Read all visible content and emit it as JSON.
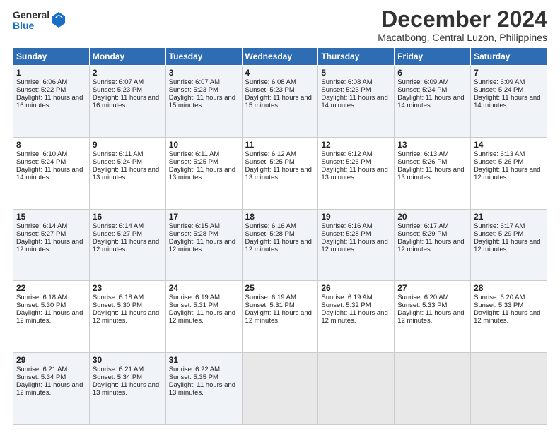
{
  "logo": {
    "general": "General",
    "blue": "Blue"
  },
  "title": "December 2024",
  "subtitle": "Macatbong, Central Luzon, Philippines",
  "days": [
    "Sunday",
    "Monday",
    "Tuesday",
    "Wednesday",
    "Thursday",
    "Friday",
    "Saturday"
  ],
  "weeks": [
    [
      {
        "day": "1",
        "sunrise": "Sunrise: 6:06 AM",
        "sunset": "Sunset: 5:22 PM",
        "daylight": "Daylight: 11 hours and 16 minutes."
      },
      {
        "day": "2",
        "sunrise": "Sunrise: 6:07 AM",
        "sunset": "Sunset: 5:23 PM",
        "daylight": "Daylight: 11 hours and 16 minutes."
      },
      {
        "day": "3",
        "sunrise": "Sunrise: 6:07 AM",
        "sunset": "Sunset: 5:23 PM",
        "daylight": "Daylight: 11 hours and 15 minutes."
      },
      {
        "day": "4",
        "sunrise": "Sunrise: 6:08 AM",
        "sunset": "Sunset: 5:23 PM",
        "daylight": "Daylight: 11 hours and 15 minutes."
      },
      {
        "day": "5",
        "sunrise": "Sunrise: 6:08 AM",
        "sunset": "Sunset: 5:23 PM",
        "daylight": "Daylight: 11 hours and 14 minutes."
      },
      {
        "day": "6",
        "sunrise": "Sunrise: 6:09 AM",
        "sunset": "Sunset: 5:24 PM",
        "daylight": "Daylight: 11 hours and 14 minutes."
      },
      {
        "day": "7",
        "sunrise": "Sunrise: 6:09 AM",
        "sunset": "Sunset: 5:24 PM",
        "daylight": "Daylight: 11 hours and 14 minutes."
      }
    ],
    [
      {
        "day": "8",
        "sunrise": "Sunrise: 6:10 AM",
        "sunset": "Sunset: 5:24 PM",
        "daylight": "Daylight: 11 hours and 14 minutes."
      },
      {
        "day": "9",
        "sunrise": "Sunrise: 6:11 AM",
        "sunset": "Sunset: 5:24 PM",
        "daylight": "Daylight: 11 hours and 13 minutes."
      },
      {
        "day": "10",
        "sunrise": "Sunrise: 6:11 AM",
        "sunset": "Sunset: 5:25 PM",
        "daylight": "Daylight: 11 hours and 13 minutes."
      },
      {
        "day": "11",
        "sunrise": "Sunrise: 6:12 AM",
        "sunset": "Sunset: 5:25 PM",
        "daylight": "Daylight: 11 hours and 13 minutes."
      },
      {
        "day": "12",
        "sunrise": "Sunrise: 6:12 AM",
        "sunset": "Sunset: 5:26 PM",
        "daylight": "Daylight: 11 hours and 13 minutes."
      },
      {
        "day": "13",
        "sunrise": "Sunrise: 6:13 AM",
        "sunset": "Sunset: 5:26 PM",
        "daylight": "Daylight: 11 hours and 13 minutes."
      },
      {
        "day": "14",
        "sunrise": "Sunrise: 6:13 AM",
        "sunset": "Sunset: 5:26 PM",
        "daylight": "Daylight: 11 hours and 12 minutes."
      }
    ],
    [
      {
        "day": "15",
        "sunrise": "Sunrise: 6:14 AM",
        "sunset": "Sunset: 5:27 PM",
        "daylight": "Daylight: 11 hours and 12 minutes."
      },
      {
        "day": "16",
        "sunrise": "Sunrise: 6:14 AM",
        "sunset": "Sunset: 5:27 PM",
        "daylight": "Daylight: 11 hours and 12 minutes."
      },
      {
        "day": "17",
        "sunrise": "Sunrise: 6:15 AM",
        "sunset": "Sunset: 5:28 PM",
        "daylight": "Daylight: 11 hours and 12 minutes."
      },
      {
        "day": "18",
        "sunrise": "Sunrise: 6:16 AM",
        "sunset": "Sunset: 5:28 PM",
        "daylight": "Daylight: 11 hours and 12 minutes."
      },
      {
        "day": "19",
        "sunrise": "Sunrise: 6:16 AM",
        "sunset": "Sunset: 5:28 PM",
        "daylight": "Daylight: 11 hours and 12 minutes."
      },
      {
        "day": "20",
        "sunrise": "Sunrise: 6:17 AM",
        "sunset": "Sunset: 5:29 PM",
        "daylight": "Daylight: 11 hours and 12 minutes."
      },
      {
        "day": "21",
        "sunrise": "Sunrise: 6:17 AM",
        "sunset": "Sunset: 5:29 PM",
        "daylight": "Daylight: 11 hours and 12 minutes."
      }
    ],
    [
      {
        "day": "22",
        "sunrise": "Sunrise: 6:18 AM",
        "sunset": "Sunset: 5:30 PM",
        "daylight": "Daylight: 11 hours and 12 minutes."
      },
      {
        "day": "23",
        "sunrise": "Sunrise: 6:18 AM",
        "sunset": "Sunset: 5:30 PM",
        "daylight": "Daylight: 11 hours and 12 minutes."
      },
      {
        "day": "24",
        "sunrise": "Sunrise: 6:19 AM",
        "sunset": "Sunset: 5:31 PM",
        "daylight": "Daylight: 11 hours and 12 minutes."
      },
      {
        "day": "25",
        "sunrise": "Sunrise: 6:19 AM",
        "sunset": "Sunset: 5:31 PM",
        "daylight": "Daylight: 11 hours and 12 minutes."
      },
      {
        "day": "26",
        "sunrise": "Sunrise: 6:19 AM",
        "sunset": "Sunset: 5:32 PM",
        "daylight": "Daylight: 11 hours and 12 minutes."
      },
      {
        "day": "27",
        "sunrise": "Sunrise: 6:20 AM",
        "sunset": "Sunset: 5:33 PM",
        "daylight": "Daylight: 11 hours and 12 minutes."
      },
      {
        "day": "28",
        "sunrise": "Sunrise: 6:20 AM",
        "sunset": "Sunset: 5:33 PM",
        "daylight": "Daylight: 11 hours and 12 minutes."
      }
    ],
    [
      {
        "day": "29",
        "sunrise": "Sunrise: 6:21 AM",
        "sunset": "Sunset: 5:34 PM",
        "daylight": "Daylight: 11 hours and 12 minutes."
      },
      {
        "day": "30",
        "sunrise": "Sunrise: 6:21 AM",
        "sunset": "Sunset: 5:34 PM",
        "daylight": "Daylight: 11 hours and 13 minutes."
      },
      {
        "day": "31",
        "sunrise": "Sunrise: 6:22 AM",
        "sunset": "Sunset: 5:35 PM",
        "daylight": "Daylight: 11 hours and 13 minutes."
      },
      null,
      null,
      null,
      null
    ]
  ]
}
